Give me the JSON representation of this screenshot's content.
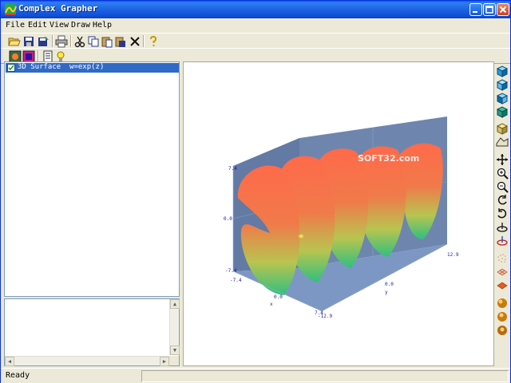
{
  "window": {
    "title": "Complex Grapher"
  },
  "menu": [
    "File",
    "Edit",
    "View",
    "Draw",
    "Help"
  ],
  "toolbar1": {
    "icons": [
      "open-folder-icon",
      "save-icon",
      "save-as-icon",
      "print-icon",
      "cut-icon",
      "copy-icon",
      "paste-icon",
      "paste-special-icon",
      "delete-icon",
      "help-icon"
    ]
  },
  "toolbar2": {
    "icons": [
      "graph-properties-icon",
      "color-palette-icon",
      "notes-icon",
      "hint-icon"
    ]
  },
  "tree": {
    "items": [
      {
        "label": "3D Surface  w=exp(z)",
        "checked": true,
        "selected": true
      }
    ]
  },
  "graph": {
    "watermark": "SOFT32.com",
    "axis_labels": {
      "z_top": "7.4",
      "z_mid": "0.0",
      "z_bot": "-7.4",
      "x_left": "-7.4",
      "x_mid": "0.0",
      "x_right": "7.4",
      "x_axis": "x",
      "y_axis": "y",
      "y_front": "0.0",
      "y_right": "12.9",
      "y_left": "-12.9"
    },
    "colors": {
      "panel": "#6e86ae",
      "floor": "#7d97c4",
      "surface_hi": "#ff6a4a",
      "surface_lo": "#2fbf7f"
    }
  },
  "right_toolbar": {
    "icons": [
      "view-front-cube-icon",
      "view-top-cube-icon",
      "view-side-cube-icon",
      "view-iso-cube-icon",
      "box-view-icon",
      "surface-view-icon",
      "pan-icon",
      "zoom-in-icon",
      "zoom-out-icon",
      "rotate-x-icon",
      "rotate-y-icon",
      "rotate-z-icon",
      "reset-rotate-icon",
      "grid-dots-icon",
      "mesh-icon",
      "shaded-icon",
      "sphere-light-1-icon",
      "sphere-light-2-icon",
      "sphere-light-3-icon"
    ]
  },
  "status": {
    "text": "Ready"
  }
}
